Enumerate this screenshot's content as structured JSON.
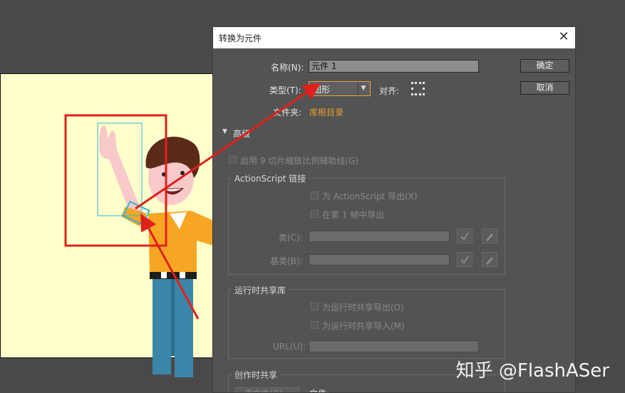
{
  "dialog": {
    "title": "转换为元件",
    "close_label": "✕",
    "name_label": "名称(N):",
    "name_value": "元件 1",
    "type_label": "类型(T):",
    "type_value": "图形",
    "align_label": "对齐:",
    "folder_label": "文件夹:",
    "folder_value": "库根目录",
    "ok_label": "确定",
    "cancel_label": "取消",
    "advanced_label": "高级",
    "slice9_label": "启用 9 切片缩放比例辅助线(G)",
    "actionscript": {
      "title": "ActionScript 链接",
      "export_as": "为 ActionScript 导出(X)",
      "export_frame": "在第 1 帧中导出",
      "class_label": "类(C):",
      "base_class_label": "基类(B):"
    },
    "runtime": {
      "title": "运行时共享库",
      "export_runtime": "为运行时共享导出(O)",
      "import_runtime": "为运行时共享导入(M)",
      "url_label": "URL(U):"
    },
    "authoring": {
      "title": "创作时共享",
      "source_button": "源文件(R)...",
      "file_label": "文件:"
    }
  },
  "watermark": "知乎 @FlashASer",
  "colors": {
    "workspace": "#494949",
    "stage": "#ffffcc",
    "dialog_bg": "#535353",
    "accent_link": "#e0a22a",
    "highlight_border": "#e8a33c",
    "annotation_red": "#e0201a"
  }
}
